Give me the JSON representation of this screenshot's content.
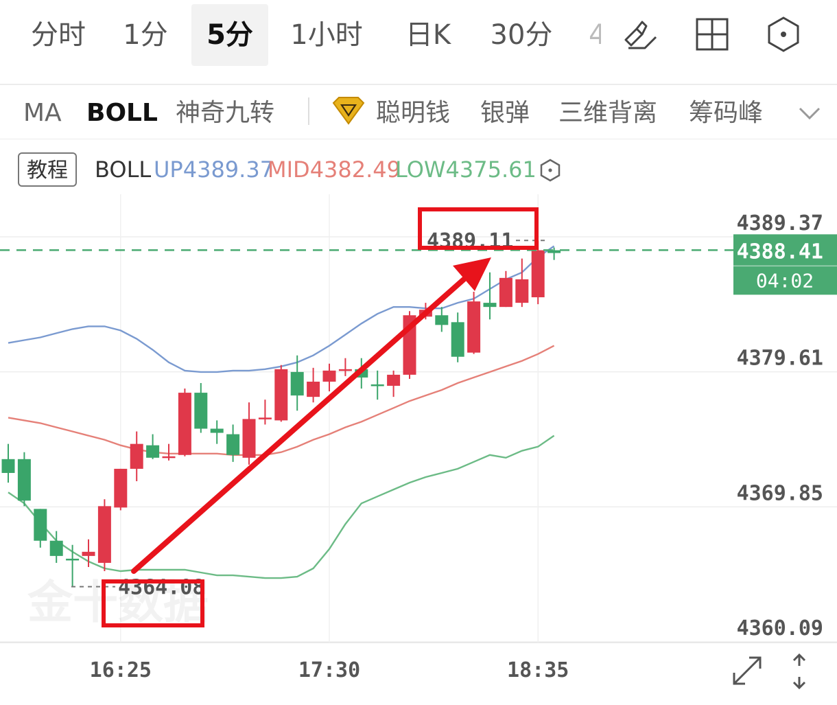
{
  "tabs": {
    "items": [
      "分时",
      "1分",
      "5分",
      "1小时",
      "日K",
      "30分"
    ],
    "active_index": 2,
    "clipped_text": "4"
  },
  "toolbar": {
    "draw_icon": "pen-ruler-icon",
    "layout_icon": "grid-icon",
    "settings_icon": "hexagon-settings-icon"
  },
  "indicators": {
    "items": [
      "MA",
      "BOLL",
      "神奇九转"
    ],
    "active": "BOLL",
    "premium_icon": "diamond-badge-icon",
    "premium_items": [
      "聪明钱",
      "银弹",
      "三维背离",
      "筹码峰"
    ],
    "more_icon": "chevron-down-icon"
  },
  "legend": {
    "tutorial_label": "教程",
    "name": "BOLL",
    "up": "UP4389.37",
    "mid": "MID4382.49",
    "low": "LOW4375.61",
    "settings_icon": "hexagon-settings-icon"
  },
  "colors": {
    "up_line": "#7a9ad0",
    "mid_line": "#e58078",
    "low_line": "#6cbb86",
    "rise": "#e0384a",
    "fall": "#3aa56a",
    "current_price": "#4aaa72",
    "annotation": "#e8131b"
  },
  "chart_data": {
    "type": "candlestick",
    "interval": "5分",
    "ylim": [
      4360.09,
      4389.37
    ],
    "yticks": [
      "4389.37",
      "4379.61",
      "4369.85",
      "4360.09"
    ],
    "xticks": [
      "16:25",
      "17:30",
      "18:35"
    ],
    "current_price": "4388.41",
    "countdown": "04:02",
    "high_label": "4389.11",
    "low_label": "4364.08",
    "watermark": "金十数据",
    "candles": [
      {
        "o": 4373.3,
        "h": 4374.4,
        "l": 4371.6,
        "c": 4372.3
      },
      {
        "o": 4373.3,
        "h": 4373.8,
        "l": 4369.9,
        "c": 4370.3
      },
      {
        "o": 4369.7,
        "h": 4369.7,
        "l": 4366.9,
        "c": 4367.4
      },
      {
        "o": 4367.4,
        "h": 4368.1,
        "l": 4365.8,
        "c": 4366.3
      },
      {
        "o": 4366.1,
        "h": 4367.1,
        "l": 4364.1,
        "c": 4366.0
      },
      {
        "o": 4366.3,
        "h": 4367.5,
        "l": 4365.5,
        "c": 4366.6
      },
      {
        "o": 4365.8,
        "h": 4370.4,
        "l": 4365.2,
        "c": 4369.9
      },
      {
        "o": 4369.8,
        "h": 4372.6,
        "l": 4369.6,
        "c": 4372.6
      },
      {
        "o": 4372.6,
        "h": 4375.3,
        "l": 4371.7,
        "c": 4374.4
      },
      {
        "o": 4374.3,
        "h": 4375.1,
        "l": 4373.3,
        "c": 4373.4
      },
      {
        "o": 4373.4,
        "h": 4374.4,
        "l": 4373.2,
        "c": 4373.5
      },
      {
        "o": 4373.6,
        "h": 4378.4,
        "l": 4373.5,
        "c": 4378.1
      },
      {
        "o": 4378.1,
        "h": 4378.8,
        "l": 4375.2,
        "c": 4375.5
      },
      {
        "o": 4375.5,
        "h": 4376.1,
        "l": 4374.4,
        "c": 4375.2
      },
      {
        "o": 4375.1,
        "h": 4375.8,
        "l": 4373.1,
        "c": 4373.6
      },
      {
        "o": 4373.4,
        "h": 4377.4,
        "l": 4372.9,
        "c": 4376.2
      },
      {
        "o": 4376.2,
        "h": 4377.6,
        "l": 4375.8,
        "c": 4376.3
      },
      {
        "o": 4376.1,
        "h": 4380.1,
        "l": 4376.0,
        "c": 4379.8
      },
      {
        "o": 4379.6,
        "h": 4380.8,
        "l": 4376.8,
        "c": 4377.9
      },
      {
        "o": 4377.8,
        "h": 4379.9,
        "l": 4377.4,
        "c": 4378.9
      },
      {
        "o": 4378.9,
        "h": 4380.2,
        "l": 4378.2,
        "c": 4379.7
      },
      {
        "o": 4379.8,
        "h": 4380.6,
        "l": 4379.3,
        "c": 4379.8
      },
      {
        "o": 4379.8,
        "h": 4380.6,
        "l": 4378.4,
        "c": 4379.2
      },
      {
        "o": 4378.7,
        "h": 4379.7,
        "l": 4377.6,
        "c": 4378.6
      },
      {
        "o": 4378.6,
        "h": 4379.7,
        "l": 4377.8,
        "c": 4379.4
      },
      {
        "o": 4379.4,
        "h": 4384.0,
        "l": 4379.1,
        "c": 4383.7
      },
      {
        "o": 4383.6,
        "h": 4384.6,
        "l": 4383.4,
        "c": 4384.1
      },
      {
        "o": 4383.7,
        "h": 4384.3,
        "l": 4382.5,
        "c": 4383.0
      },
      {
        "o": 4383.2,
        "h": 4383.9,
        "l": 4380.3,
        "c": 4380.7
      },
      {
        "o": 4381.0,
        "h": 4385.4,
        "l": 4380.9,
        "c": 4384.7
      },
      {
        "o": 4384.6,
        "h": 4386.8,
        "l": 4383.4,
        "c": 4384.3
      },
      {
        "o": 4384.3,
        "h": 4386.9,
        "l": 4384.3,
        "c": 4386.4
      },
      {
        "o": 4384.6,
        "h": 4387.8,
        "l": 4384.3,
        "c": 4386.3
      },
      {
        "o": 4385.0,
        "h": 4389.1,
        "l": 4384.5,
        "c": 4388.4
      },
      {
        "o": 4388.4,
        "h": 4388.6,
        "l": 4387.7,
        "c": 4388.2
      }
    ],
    "boll_up": [
      4381.7,
      4381.9,
      4382.1,
      4382.4,
      4382.7,
      4382.9,
      4382.9,
      4382.6,
      4382.0,
      4381.2,
      4380.3,
      4379.7,
      4379.6,
      4379.6,
      4379.7,
      4379.7,
      4379.8,
      4380.0,
      4380.3,
      4380.8,
      4381.5,
      4382.3,
      4383.1,
      4383.8,
      4384.3,
      4384.3,
      4384.2,
      4384.2,
      4384.6,
      4384.9,
      4385.6,
      4386.3,
      4386.8,
      4387.9,
      4388.7
    ],
    "boll_mid": [
      4376.3,
      4376.1,
      4375.9,
      4375.6,
      4375.3,
      4375.0,
      4374.7,
      4374.3,
      4374.0,
      4373.8,
      4373.7,
      4373.7,
      4373.7,
      4373.7,
      4373.6,
      4373.6,
      4373.6,
      4373.8,
      4374.2,
      4374.7,
      4375.1,
      4375.6,
      4376.0,
      4376.5,
      4377.0,
      4377.5,
      4377.9,
      4378.3,
      4378.8,
      4379.2,
      4379.6,
      4380.0,
      4380.4,
      4380.9,
      4381.5
    ],
    "boll_low": [
      4370.9,
      4370.1,
      4368.7,
      4367.4,
      4366.6,
      4365.9,
      4365.4,
      4365.2,
      4365.3,
      4365.3,
      4365.3,
      4365.3,
      4365.1,
      4364.9,
      4364.9,
      4364.8,
      4364.7,
      4364.7,
      4364.8,
      4365.4,
      4366.8,
      4368.6,
      4370.1,
      4370.6,
      4371.1,
      4371.6,
      4372.0,
      4372.3,
      4372.6,
      4373.1,
      4373.6,
      4373.4,
      4373.9,
      4374.2,
      4375.0
    ]
  }
}
